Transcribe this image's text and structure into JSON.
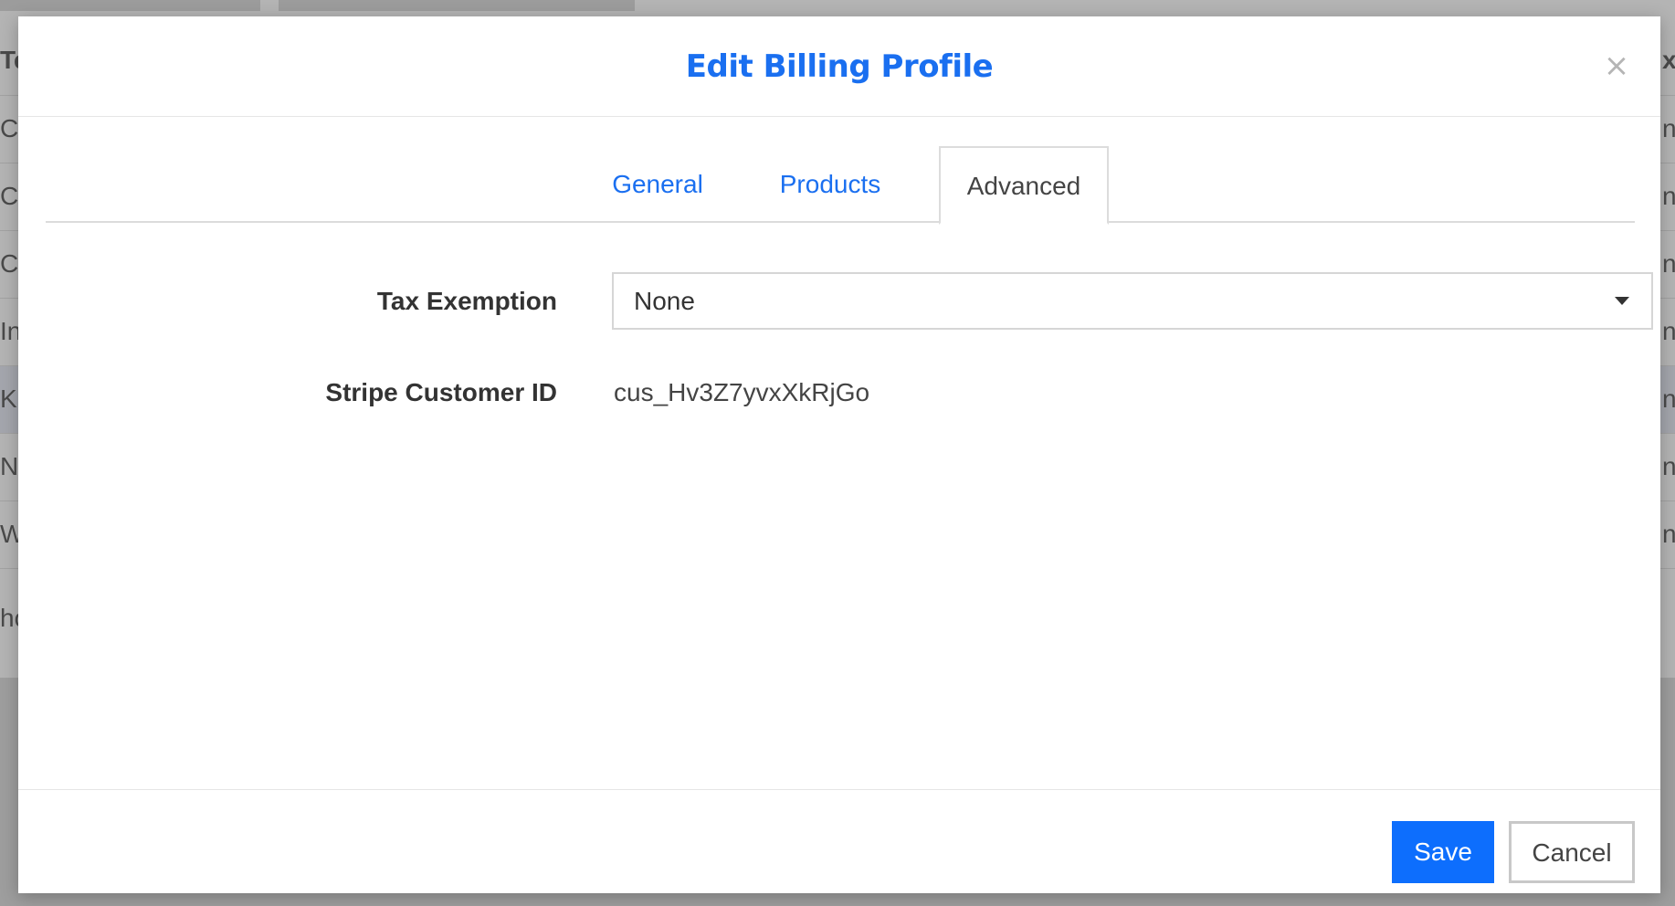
{
  "backdrop": {
    "left_col_fragments": [
      "Te",
      "Co",
      "Co",
      "Co",
      "In",
      "Ki",
      "Na",
      "W",
      "ho"
    ],
    "right_col_fragments": [
      "x",
      "n",
      "n",
      "n",
      "n",
      "n",
      "n",
      "n"
    ]
  },
  "modal": {
    "title": "Edit Billing Profile",
    "close_glyph": "×",
    "tabs": [
      {
        "label": "General",
        "active": false
      },
      {
        "label": "Products",
        "active": false
      },
      {
        "label": "Advanced",
        "active": true
      }
    ],
    "fields": {
      "tax_exemption": {
        "label": "Tax Exemption",
        "selected": "None"
      },
      "stripe_customer_id": {
        "label": "Stripe Customer ID",
        "value": "cus_Hv3Z7yvxXkRjGo"
      }
    },
    "footer": {
      "save_label": "Save",
      "cancel_label": "Cancel"
    }
  },
  "colors": {
    "accent": "#1a6ff0",
    "primary_button": "#0d6efd",
    "close_icon": "#b5b5b5"
  }
}
